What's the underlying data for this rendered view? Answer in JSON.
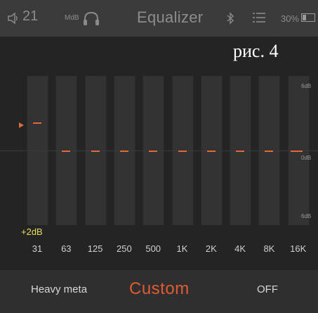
{
  "status_bar": {
    "volume": "21",
    "mdb_label": "MdB",
    "title": "Equalizer",
    "battery": "30%",
    "battery_level": 0.3,
    "icons": [
      "speaker-icon",
      "headphones-icon",
      "bluetooth-icon",
      "list-icon",
      "battery-icon"
    ]
  },
  "caption": "рис. 4",
  "equalizer": {
    "scale_top": "6dB",
    "scale_mid": "0dB",
    "scale_bottom": "6dB",
    "selected_gain": "+2dB",
    "bands": [
      {
        "label": "31",
        "gain_db": 2
      },
      {
        "label": "63",
        "gain_db": 0
      },
      {
        "label": "125",
        "gain_db": 0
      },
      {
        "label": "250",
        "gain_db": 0
      },
      {
        "label": "500",
        "gain_db": 0
      },
      {
        "label": "1K",
        "gain_db": 0
      },
      {
        "label": "2K",
        "gain_db": 0
      },
      {
        "label": "4K",
        "gain_db": 0
      },
      {
        "label": "8K",
        "gain_db": 0
      },
      {
        "label": "16K",
        "gain_db": 0
      }
    ],
    "accent_color": "#e06a3c",
    "gain_color": "#e8de5c"
  },
  "bottom_bar": {
    "preset": "Heavy meta",
    "mode": "Custom",
    "power": "OFF",
    "mode_color": "#e05b33"
  }
}
